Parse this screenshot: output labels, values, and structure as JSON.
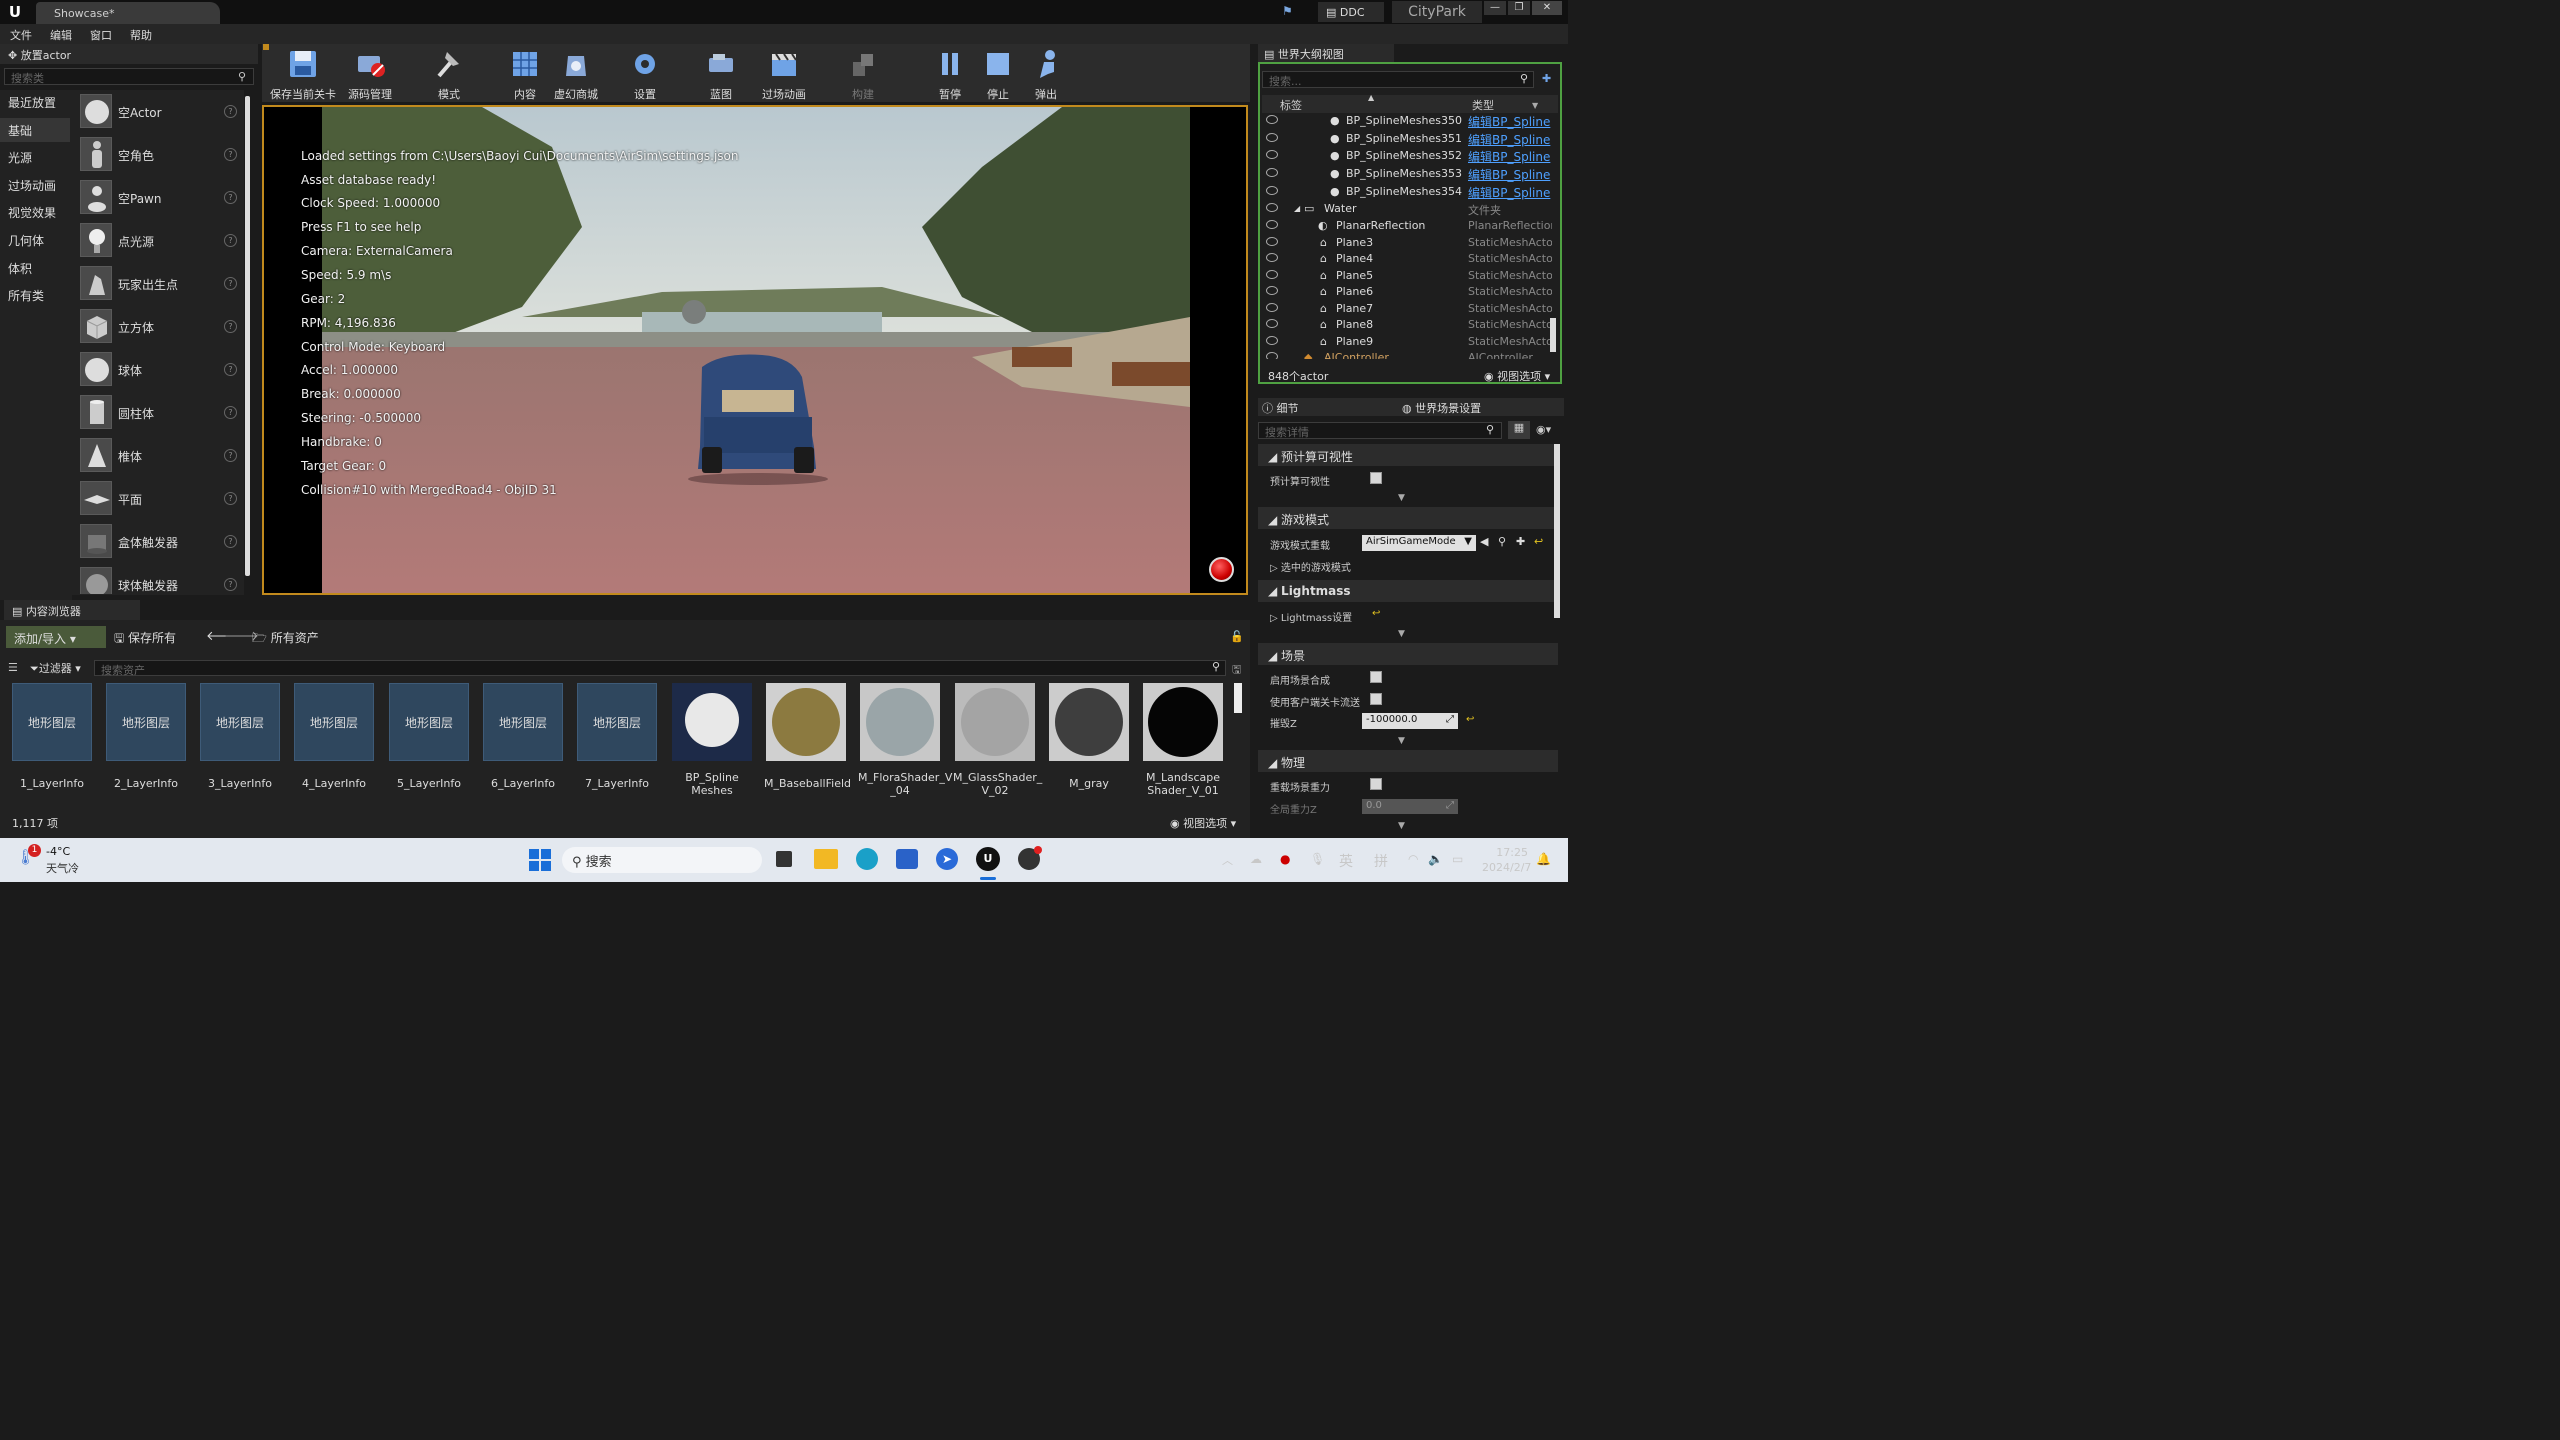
{
  "title_bar": {
    "document_tab": "Showcase*",
    "ddc": "DDC",
    "project": "CityPark"
  },
  "menu": [
    "文件",
    "编辑",
    "窗口",
    "帮助"
  ],
  "place_actor": {
    "header": "放置actor",
    "search_placeholder": "搜索类",
    "categories": [
      "最近放置",
      "基础",
      "光源",
      "过场动画",
      "视觉效果",
      "几何体",
      "体积",
      "所有类"
    ],
    "selected_category": "基础",
    "items": [
      "空Actor",
      "空角色",
      "空Pawn",
      "点光源",
      "玩家出生点",
      "立方体",
      "球体",
      "圆柱体",
      "椎体",
      "平面",
      "盒体触发器",
      "球体触发器"
    ]
  },
  "toolbar": {
    "buttons": [
      "保存当前关卡",
      "源码管理",
      "模式",
      "内容",
      "虚幻商城",
      "设置",
      "蓝图",
      "过场动画",
      "构建",
      "暂停",
      "停止",
      "弹出"
    ]
  },
  "viewport_log": [
    "Loaded settings from C:\\Users\\Baoyi Cui\\Documents\\AirSim\\settings.json",
    "Asset database ready!",
    "Clock Speed: 1.000000",
    "Press F1 to see help",
    "Camera: ExternalCamera",
    "Speed: 5.9 m\\s",
    "Gear: 2",
    "RPM: 4,196.836",
    "Control Mode: Keyboard",
    "Accel: 1.000000",
    "Break: 0.000000",
    "Steering: -0.500000",
    "Handbrake: 0",
    "Target Gear: 0",
    "Collision#10 with MergedRoad4 - ObjID 31"
  ],
  "outliner": {
    "tab": "世界大纲视图",
    "search_placeholder": "搜索...",
    "col_label": "标签",
    "col_type": "类型",
    "rows": [
      {
        "name": "BP_SplineMeshes350",
        "type": "编辑BP_Spline"
      },
      {
        "name": "BP_SplineMeshes351",
        "type": "编辑BP_Spline"
      },
      {
        "name": "BP_SplineMeshes352",
        "type": "编辑BP_Spline"
      },
      {
        "name": "BP_SplineMeshes353",
        "type": "编辑BP_Spline"
      },
      {
        "name": "BP_SplineMeshes354",
        "type": "编辑BP_Spline"
      },
      {
        "name": "Water",
        "type": "文件夹"
      },
      {
        "name": "PlanarReflection",
        "type": "PlanarReflection"
      },
      {
        "name": "Plane3",
        "type": "StaticMeshActor"
      },
      {
        "name": "Plane4",
        "type": "StaticMeshActor"
      },
      {
        "name": "Plane5",
        "type": "StaticMeshActor"
      },
      {
        "name": "Plane6",
        "type": "StaticMeshActor"
      },
      {
        "name": "Plane7",
        "type": "StaticMeshActor"
      },
      {
        "name": "Plane8",
        "type": "StaticMeshActor"
      },
      {
        "name": "Plane9",
        "type": "StaticMeshActor"
      },
      {
        "name": "AIController",
        "type": "AIController"
      }
    ],
    "count": "848个actor",
    "view_options": "视图选项"
  },
  "details": {
    "tab_details": "细节",
    "tab_world": "世界场景设置",
    "search_placeholder": "搜索详情",
    "sections": {
      "precomputed": "预计算可视性",
      "precomputed_prop": "预计算可视性",
      "gamemode": "游戏模式",
      "gamemode_override": "游戏模式重载",
      "gamemode_value": "AirSimGameMode",
      "selected_gamemode": "选中的游戏模式",
      "lightmass": "Lightmass",
      "lightmass_settings": "Lightmass设置",
      "scene": "场景",
      "enable_composition": "启用场景合成",
      "client_streaming": "使用客户端关卡流送",
      "kill_z": "摧毁Z",
      "kill_z_value": "-100000.0",
      "physics": "物理",
      "override_gravity": "重载场景重力",
      "global_gravity": "全局重力Z",
      "global_gravity_value": "0.0"
    }
  },
  "content_browser": {
    "tab": "内容浏览器",
    "add_import": "添加/导入",
    "save_all": "保存所有",
    "path": "所有资产",
    "filter": "过滤器",
    "search_placeholder": "搜索资产",
    "layer_thumb_text": "地形图层",
    "assets": [
      {
        "name": "1_LayerInfo",
        "kind": "layer"
      },
      {
        "name": "2_LayerInfo",
        "kind": "layer"
      },
      {
        "name": "3_LayerInfo",
        "kind": "layer"
      },
      {
        "name": "4_LayerInfo",
        "kind": "layer"
      },
      {
        "name": "5_LayerInfo",
        "kind": "layer"
      },
      {
        "name": "6_LayerInfo",
        "kind": "layer"
      },
      {
        "name": "7_LayerInfo",
        "kind": "layer"
      },
      {
        "name": "BP_Spline Meshes",
        "kind": "white"
      },
      {
        "name": "M_BaseballField",
        "kind": "dirt"
      },
      {
        "name": "M_FloraShader_V _04",
        "kind": "glossy"
      },
      {
        "name": "M_GlassShader_ V_02",
        "kind": "glass"
      },
      {
        "name": "M_gray",
        "kind": "gray"
      },
      {
        "name": "M_Landscape Shader_V_01",
        "kind": "black"
      }
    ],
    "count": "1,117 项",
    "view_options": "视图选项"
  },
  "taskbar": {
    "weather_temp": "-4°C",
    "weather_desc": "天气冷",
    "weather_badge": "1",
    "search": "搜索",
    "ime1": "英",
    "ime2": "拼",
    "time": "17:25",
    "date": "2024/2/7"
  }
}
